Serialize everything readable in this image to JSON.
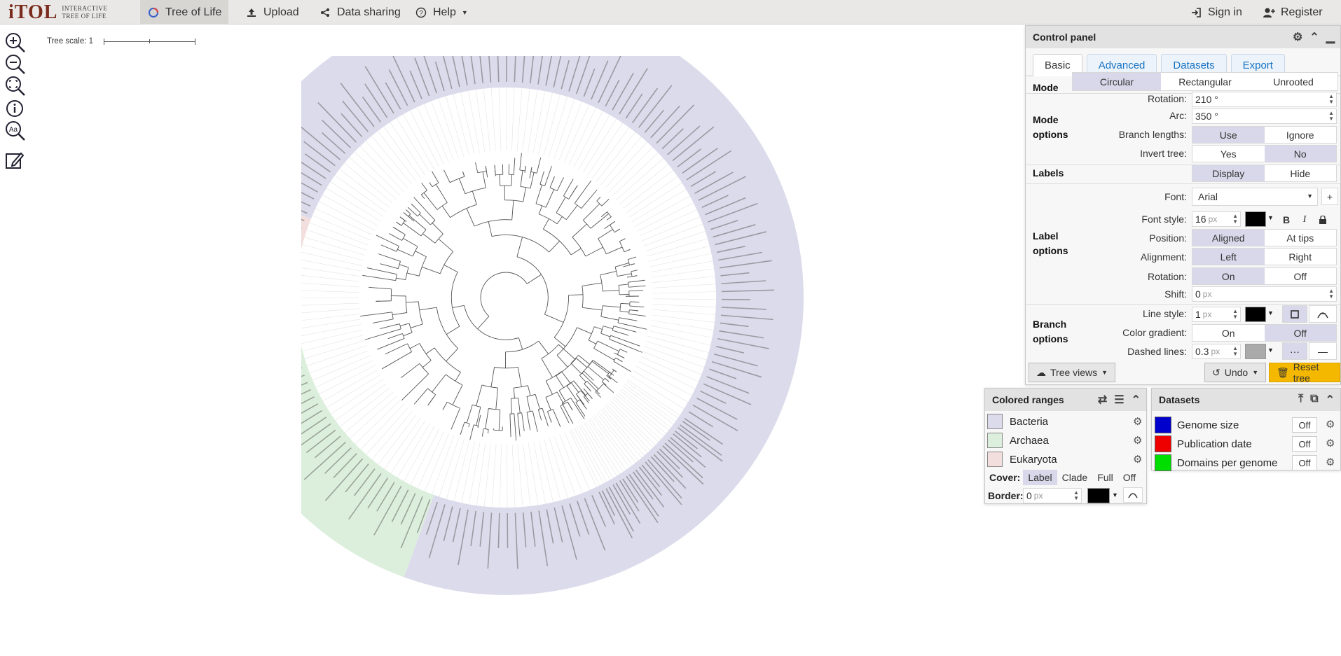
{
  "app": {
    "logo_main": "iTOL",
    "logo_sub_1": "Interactive",
    "logo_sub_2": "Tree Of Life"
  },
  "nav": {
    "tree_of_life": "Tree of Life",
    "upload": "Upload",
    "data_sharing": "Data sharing",
    "help": "Help",
    "sign_in": "Sign in",
    "register": "Register"
  },
  "canvas": {
    "tree_scale_label": "Tree scale: 1"
  },
  "control_panel": {
    "title": "Control panel",
    "tabs": [
      "Basic",
      "Advanced",
      "Datasets",
      "Export"
    ],
    "active_tab": "Basic",
    "mode": {
      "label": "Mode",
      "options": [
        "Circular",
        "Rectangular",
        "Unrooted"
      ],
      "selected": "Circular"
    },
    "mode_options": {
      "label_line1": "Mode",
      "label_line2": "options",
      "rotation_label": "Rotation:",
      "rotation_value": "210 °",
      "arc_label": "Arc:",
      "arc_value": "350 °",
      "branch_lengths_label": "Branch lengths:",
      "branch_lengths_options": [
        "Use",
        "Ignore"
      ],
      "branch_lengths_selected": "Use",
      "invert_tree_label": "Invert tree:",
      "invert_tree_options": [
        "Yes",
        "No"
      ],
      "invert_tree_selected": "No"
    },
    "labels": {
      "label": "Labels",
      "options": [
        "Display",
        "Hide"
      ],
      "selected": "Display"
    },
    "label_options": {
      "label_line1": "Label",
      "label_line2": "options",
      "font_label": "Font:",
      "font_value": "Arial",
      "font_style_label": "Font style:",
      "font_size_value": "16",
      "font_size_unit": "px",
      "font_color": "#000000",
      "position_label": "Position:",
      "position_options": [
        "Aligned",
        "At tips"
      ],
      "position_selected": "Aligned",
      "alignment_label": "Alignment:",
      "alignment_options": [
        "Left",
        "Right"
      ],
      "alignment_selected": "Left",
      "rotation_label": "Rotation:",
      "rotation_options": [
        "On",
        "Off"
      ],
      "rotation_selected": "On",
      "shift_label": "Shift:",
      "shift_value": "0",
      "shift_unit": "px"
    },
    "branch_options": {
      "label_line1": "Branch",
      "label_line2": "options",
      "line_style_label": "Line style:",
      "line_style_value": "1",
      "line_style_unit": "px",
      "line_color": "#000000",
      "color_gradient_label": "Color gradient:",
      "color_gradient_options": [
        "On",
        "Off"
      ],
      "color_gradient_selected": "Off",
      "dashed_lines_label": "Dashed lines:",
      "dashed_lines_value": "0.3",
      "dashed_lines_unit": "px",
      "dashed_color": "#aaaaaa"
    },
    "footer": {
      "tree_views": "Tree views",
      "undo": "Undo",
      "reset_tree": "Reset tree"
    }
  },
  "colored_ranges": {
    "title": "Colored ranges",
    "items": [
      {
        "label": "Bacteria",
        "color": "#dcdbeb"
      },
      {
        "label": "Archaea",
        "color": "#dcefdc"
      },
      {
        "label": "Eukaryota",
        "color": "#f3dede"
      }
    ],
    "cover_label": "Cover:",
    "cover_options": [
      "Label",
      "Clade",
      "Full",
      "Off"
    ],
    "cover_selected": "Label",
    "border_label": "Border:",
    "border_value": "0",
    "border_unit": "px",
    "border_color": "#000000"
  },
  "datasets": {
    "title": "Datasets",
    "items": [
      {
        "label": "Genome size",
        "color": "#0000cc",
        "state": "Off"
      },
      {
        "label": "Publication date",
        "color": "#ee0000",
        "state": "Off"
      },
      {
        "label": "Domains per genome",
        "color": "#00dd00",
        "state": "Off"
      }
    ]
  }
}
